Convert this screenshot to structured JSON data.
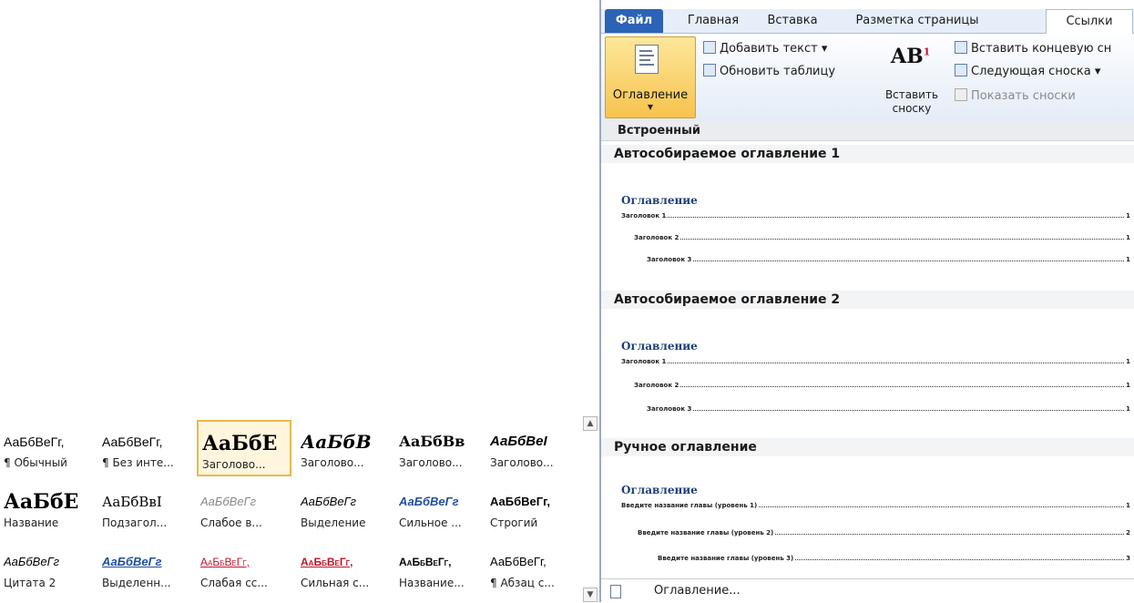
{
  "gallery": {
    "rows": [
      [
        {
          "sample": "АаБбВеГг,",
          "label": "¶ Обычный",
          "style": "normal"
        },
        {
          "sample": "АаБбВеГг,",
          "label": "¶ Без инте...",
          "style": "normal"
        },
        {
          "sample": "АаБбЕ",
          "label": "Заголово...",
          "style": "h1",
          "selected": true
        },
        {
          "sample": "АаБбВ",
          "label": "Заголово...",
          "style": "h2"
        },
        {
          "sample": "АаБбВв",
          "label": "Заголово...",
          "style": "h3"
        },
        {
          "sample": "АаБбВеІ",
          "label": "Заголово...",
          "style": "h4"
        }
      ],
      [
        {
          "sample": "АаБбЕ",
          "label": "Название",
          "style": "title"
        },
        {
          "sample": "АаБбВвІ",
          "label": "Подзагол...",
          "style": "subtitle"
        },
        {
          "sample": "АаБбВеГг",
          "label": "Слабое в...",
          "style": "subtle"
        },
        {
          "sample": "АаБбВеГг",
          "label": "Выделение",
          "style": "emph"
        },
        {
          "sample": "АаБбВеГг",
          "label": "Сильное ...",
          "style": "intense"
        },
        {
          "sample": "АаБбВеГг,",
          "label": "Строгий",
          "style": "strong"
        }
      ],
      [
        {
          "sample": "АаБбВеГг",
          "label": "Цитата 2",
          "style": "quote"
        },
        {
          "sample": "АаБбВеГг",
          "label": "Выделенн...",
          "style": "iquote"
        },
        {
          "sample": "АаБбВеГг,",
          "label": "Слабая сс...",
          "style": "sref"
        },
        {
          "sample": "АаБбВеГг,",
          "label": "Сильная с...",
          "style": "iref"
        },
        {
          "sample": "АаБбВеГг,",
          "label": "Название...",
          "style": "btitle"
        },
        {
          "sample": "АаБбВеГг,",
          "label": "¶ Абзац с...",
          "style": "normal"
        }
      ]
    ]
  },
  "ribbon": {
    "tabs": [
      "Файл",
      "Главная",
      "Вставка",
      "Разметка страницы",
      "Ссылки"
    ],
    "active_tab": "Ссылки",
    "toc_button": "Оглавление",
    "add_text": "Добавить текст ▾",
    "update_table": "Обновить таблицу",
    "insert_footnote_line1": "Вставить",
    "insert_footnote_line2": "сноску",
    "insert_endnote": "Вставить концевую сн",
    "next_footnote": "Следующая сноска ▾",
    "show_notes": "Показать сноски"
  },
  "dropdown": {
    "header": "Встроенный",
    "sections": [
      {
        "title": "Автособираемое оглавление 1",
        "toc_title": "Оглавление",
        "lines": [
          {
            "text": "Заголовок 1",
            "page": "1"
          },
          {
            "text": "Заголовок 2",
            "page": "1"
          },
          {
            "text": "Заголовок 3",
            "page": "1"
          }
        ]
      },
      {
        "title": "Автособираемое оглавление 2",
        "toc_title": "Оглавление",
        "lines": [
          {
            "text": "Заголовок 1",
            "page": "1"
          },
          {
            "text": "Заголовок 2",
            "page": "1"
          },
          {
            "text": "Заголовок 3",
            "page": "1"
          }
        ]
      },
      {
        "title": "Ручное оглавление",
        "toc_title": "Оглавление",
        "lines": [
          {
            "text": "Введите название главы (уровень 1)",
            "page": "1"
          },
          {
            "text": "Введите название главы (уровень 2)",
            "page": "2"
          },
          {
            "text": "Введите название главы (уровень 3)",
            "page": "3"
          }
        ]
      }
    ],
    "footer": "Оглавление..."
  },
  "colors": {
    "file_tab": "#2b63b6",
    "selected_button": "#f7c34e",
    "toc_heading": "#1d3f7a",
    "heading_blue": "#1f4e9c",
    "reference_red": "#c0142a"
  }
}
